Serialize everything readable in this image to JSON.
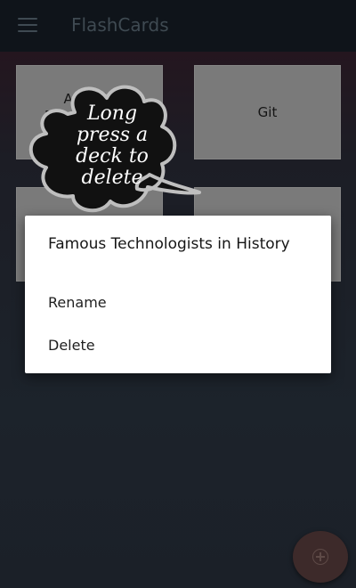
{
  "app_bar": {
    "title": "FlashCards",
    "menu_icon": "hamburger-menu-icon"
  },
  "decks": [
    {
      "label": "Android Development"
    },
    {
      "label": "Git"
    },
    {
      "label": ""
    },
    {
      "label": ""
    }
  ],
  "hint": {
    "text": "Long press a deck to delete"
  },
  "dialog": {
    "title": "Famous Technologists in History",
    "items": [
      {
        "label": "Rename"
      },
      {
        "label": "Delete"
      }
    ]
  },
  "fab": {
    "icon": "add-circle-icon"
  },
  "colors": {
    "app_bar": "#0f141a",
    "background": "#1b2027",
    "deck_tile": "#7a7a7a",
    "dialog": "#ffffff",
    "fab": "#3d2a2a"
  }
}
